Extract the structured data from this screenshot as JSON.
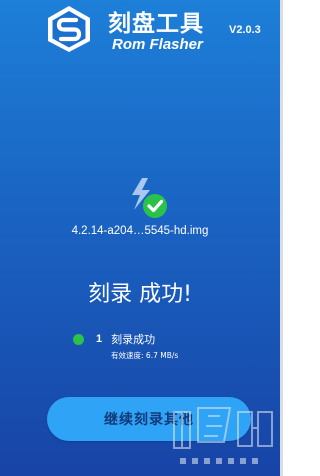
{
  "header": {
    "title_cn": "刻盘工具",
    "title_en": "Rom Flasher",
    "version": "V2.0.3"
  },
  "flash": {
    "filename": "4.2.14-a204…5545-hd.img",
    "status_title": "刻录 成功!"
  },
  "result": {
    "device_number": "1",
    "device_status": "刻录成功",
    "speed_label": "有效速度:",
    "speed_value": "6.7 MB/s"
  },
  "actions": {
    "continue_label": "继续刻录其他"
  },
  "colors": {
    "background_top": "#1d7fd8",
    "background_bottom": "#1744a6",
    "success_green": "#2bc24a",
    "button_blue": "#2fa3f5",
    "button_text": "#123a7a"
  },
  "icons": {
    "logo": "rom-flasher-logo-icon",
    "flash": "lightning-icon",
    "success": "checkmark-icon"
  }
}
